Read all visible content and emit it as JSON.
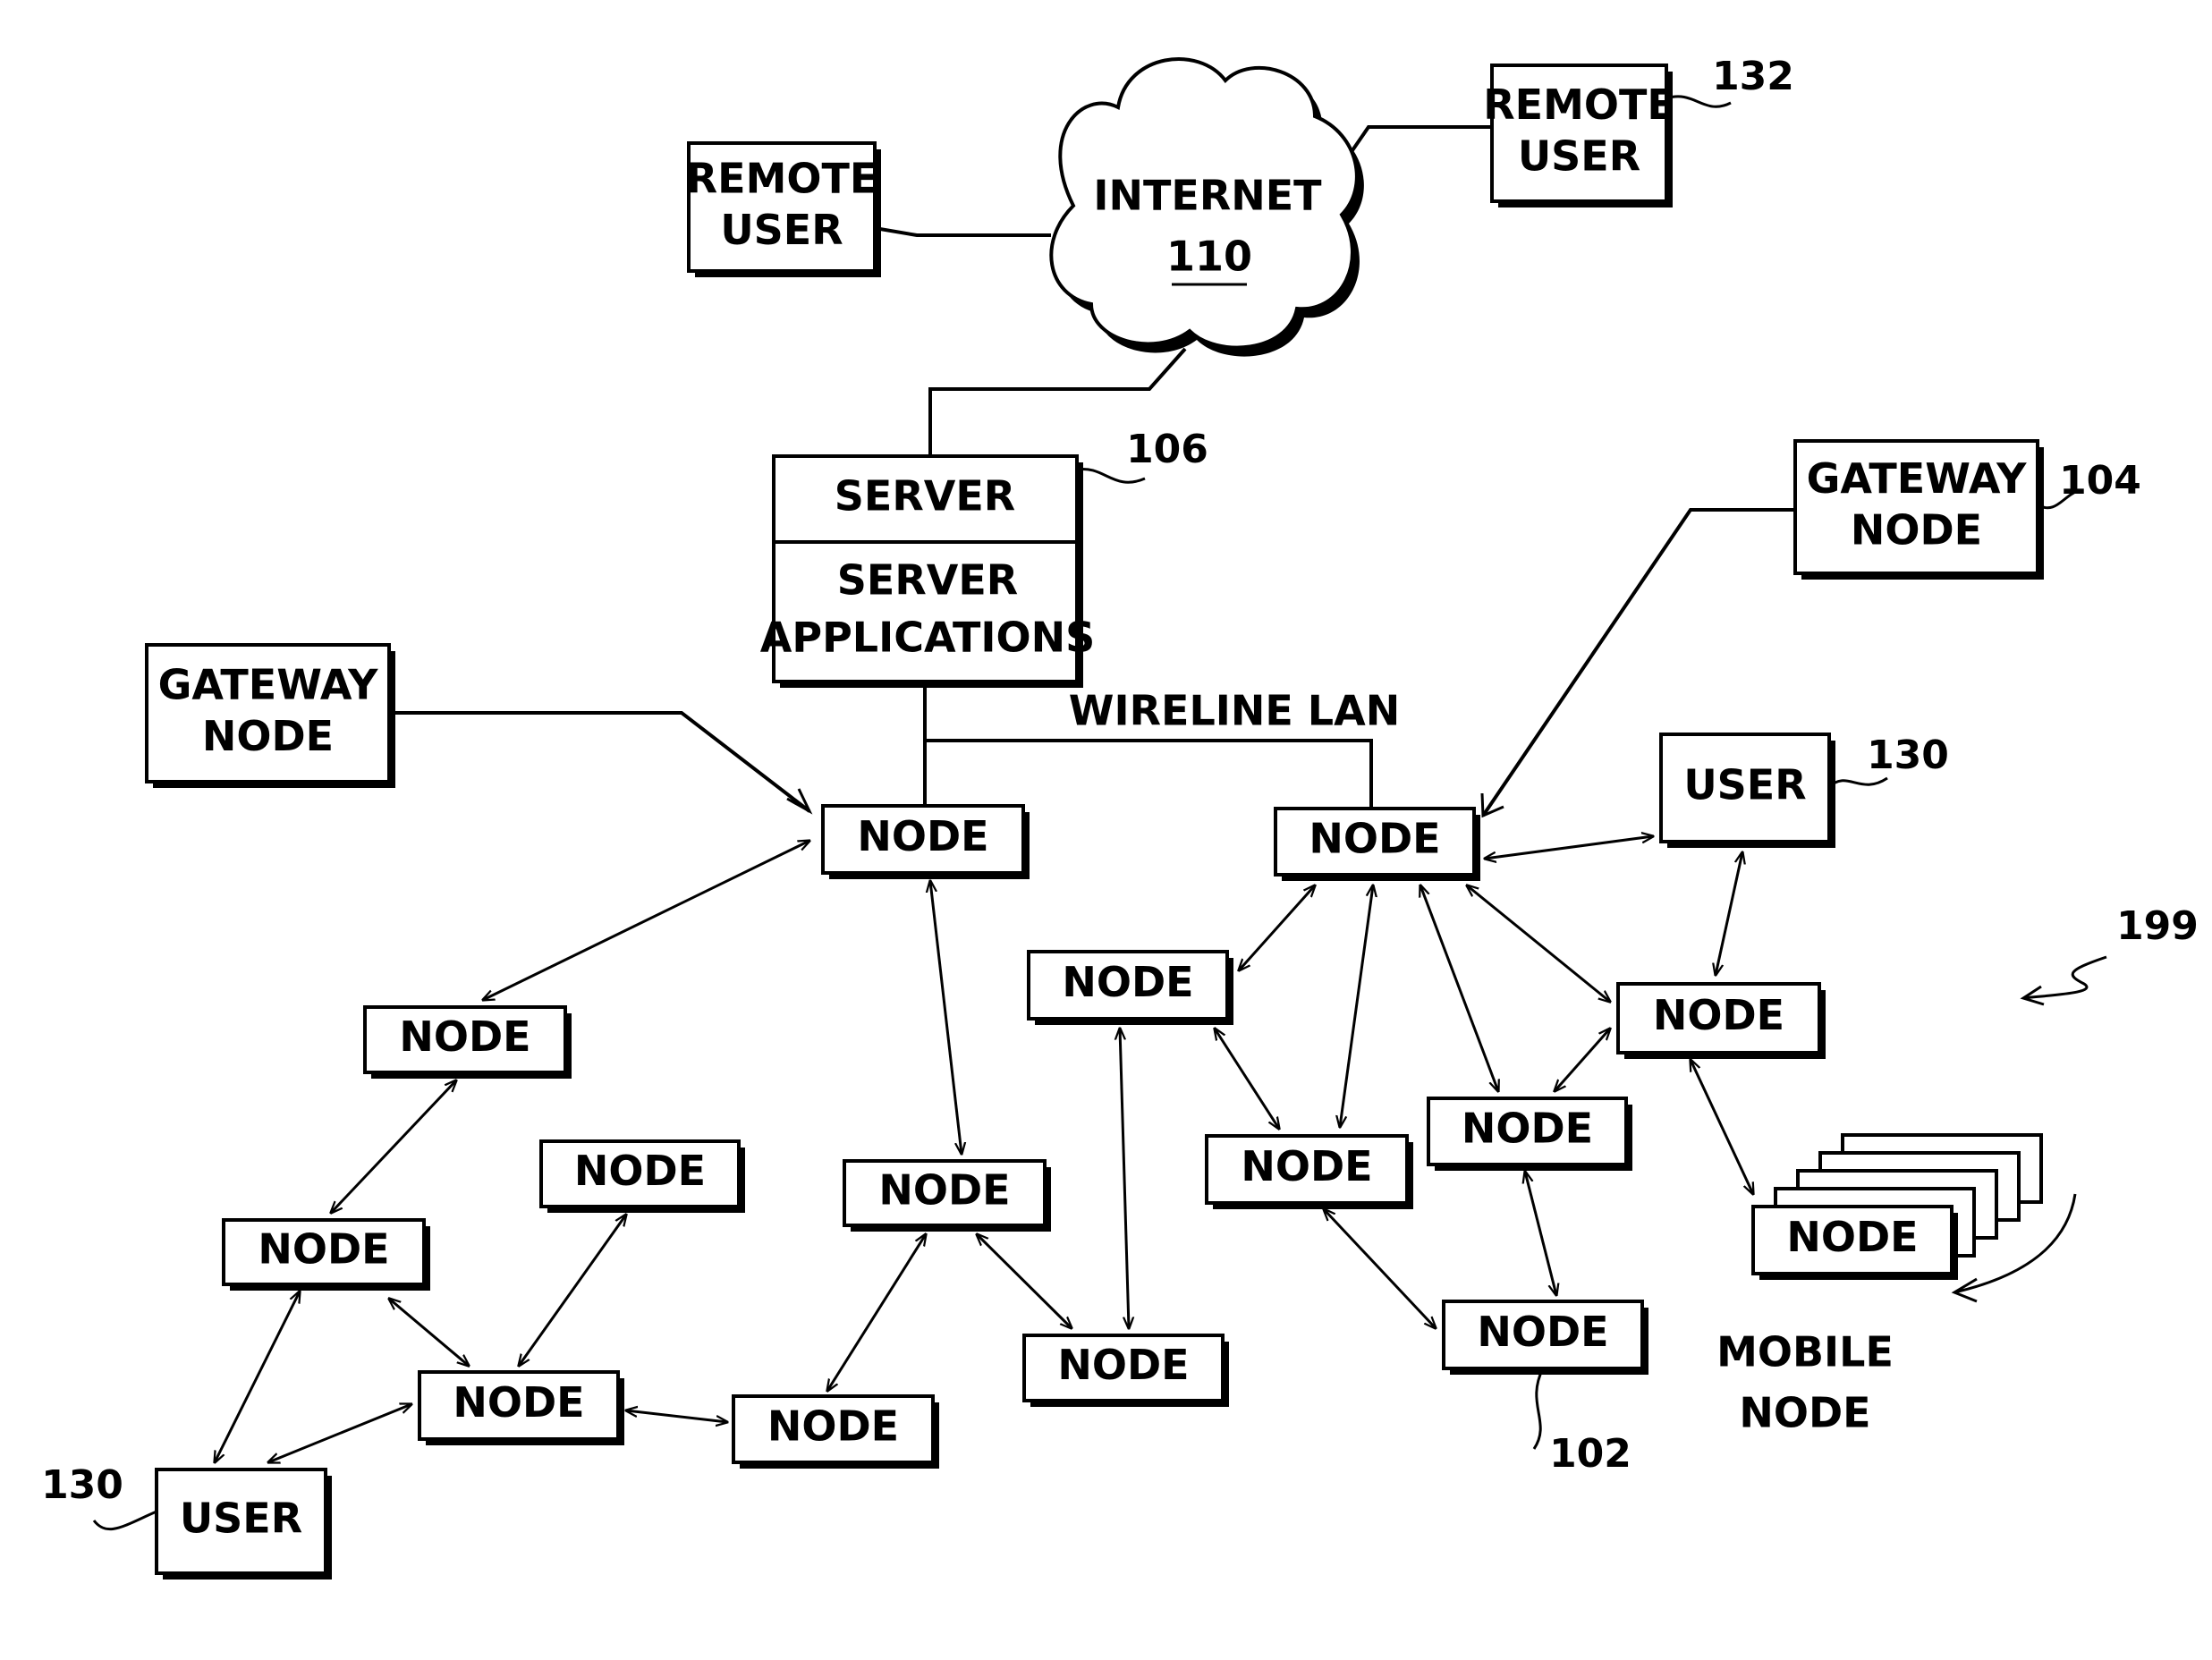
{
  "figure": {
    "ref_label": "199",
    "internet": {
      "label": "INTERNET",
      "ref": "110"
    },
    "remote_users": [
      {
        "id": "remote-left",
        "lines": [
          "REMOTE",
          "USER"
        ],
        "ref": ""
      },
      {
        "id": "remote-right",
        "lines": [
          "REMOTE",
          "USER"
        ],
        "ref": "132"
      }
    ],
    "server": {
      "title": "SERVER",
      "apps_lines": [
        "SERVER",
        "APPLICATIONS"
      ],
      "ref": "106"
    },
    "wireline_label": "WIRELINE LAN",
    "gateways": [
      {
        "id": "gw-left",
        "lines": [
          "GATEWAY",
          "NODE"
        ],
        "ref": ""
      },
      {
        "id": "gw-right",
        "lines": [
          "GATEWAY",
          "NODE"
        ],
        "ref": "104"
      }
    ],
    "users": [
      {
        "id": "user-right",
        "label": "USER",
        "ref": "130"
      },
      {
        "id": "user-left",
        "label": "USER",
        "ref": "130"
      }
    ],
    "node_label": "NODE",
    "node_ref": "102",
    "mobile": {
      "lines": [
        "MOBILE",
        "NODE"
      ]
    }
  }
}
